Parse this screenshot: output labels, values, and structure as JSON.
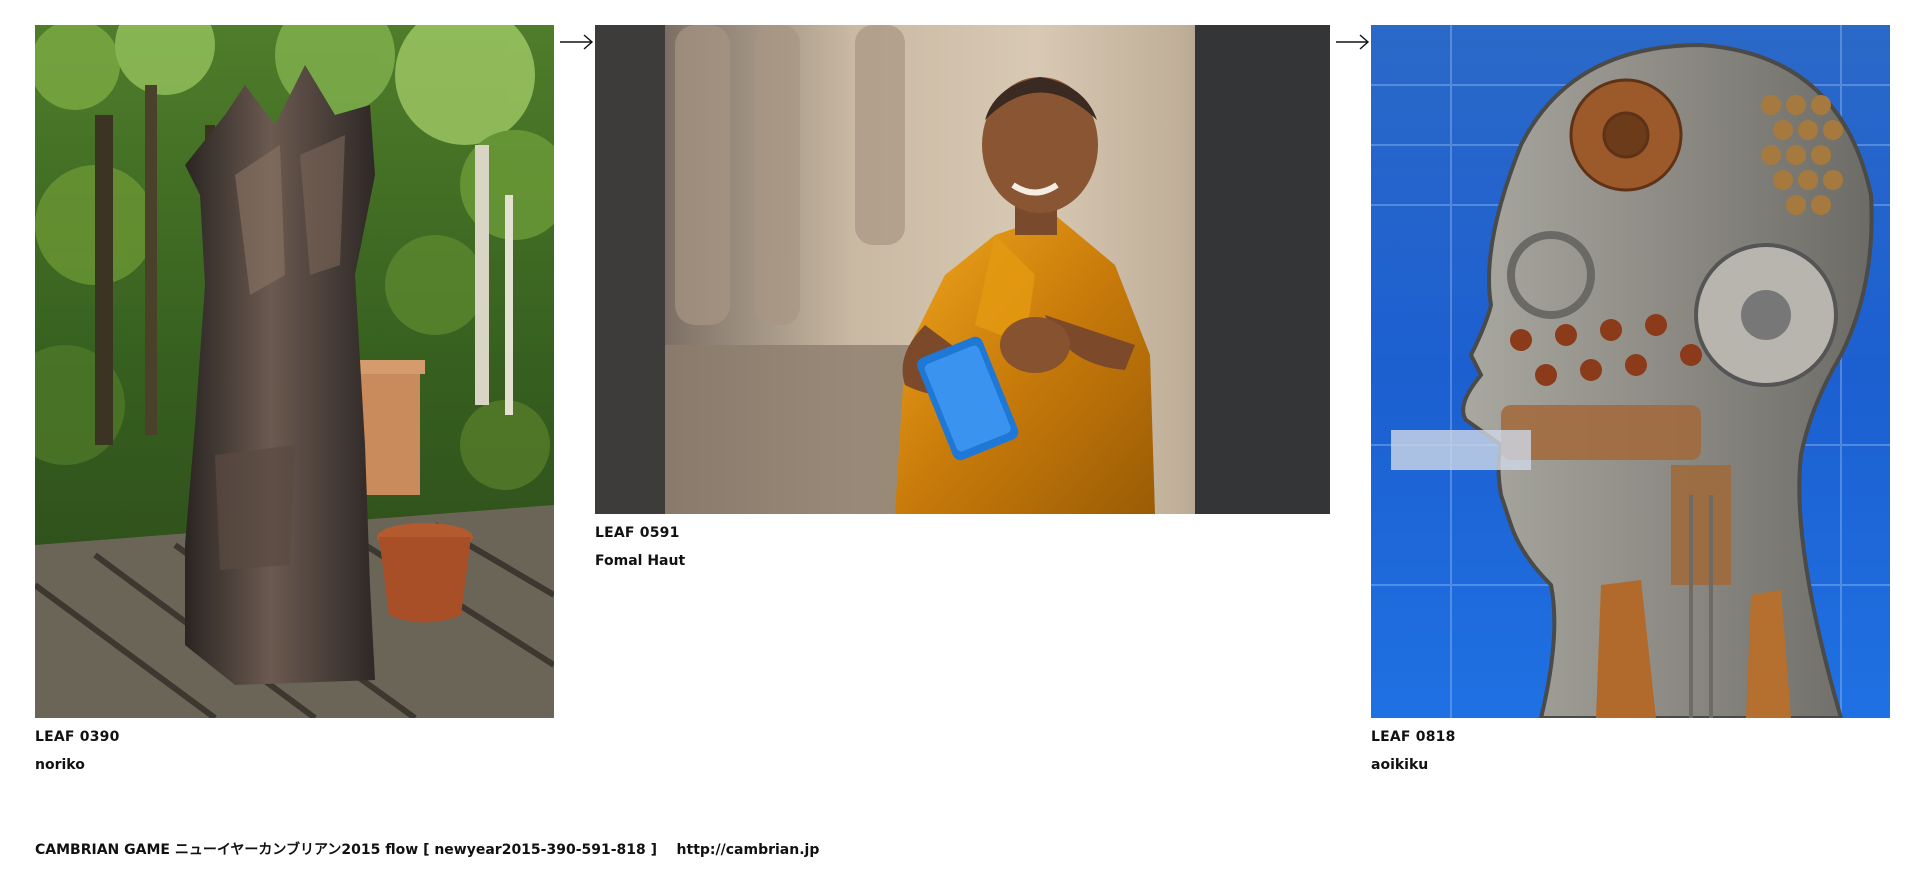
{
  "leaves": [
    {
      "id": "LEAF 0390",
      "author": "noriko",
      "image": "bronze-sculpture-in-forest-photo"
    },
    {
      "id": "LEAF 0591",
      "author": "Fomal Haut",
      "image": "monk-with-tablet-photo"
    },
    {
      "id": "LEAF 0818",
      "author": "aoikiku",
      "image": "mechanical-head-sculpture-photo"
    }
  ],
  "arrows": [
    "right-arrow-icon",
    "right-arrow-icon"
  ],
  "footer": {
    "title": "CAMBRIAN GAME ニューイヤーカンブリアン2015 flow [ newyear2015-390-591-818 ]",
    "link": "http://cambrian.jp"
  }
}
